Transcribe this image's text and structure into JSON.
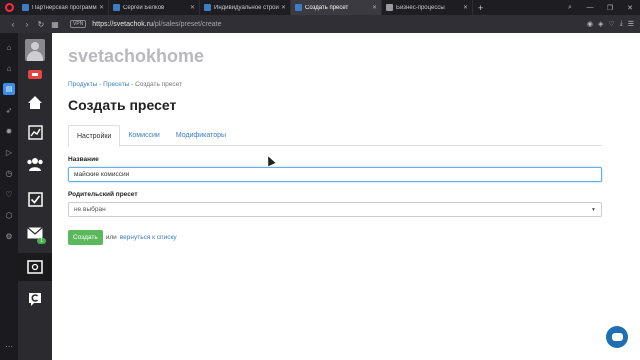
{
  "browser": {
    "tabs": [
      {
        "label": "Партнерская программа",
        "active": false
      },
      {
        "label": "Сергей Белков",
        "active": false
      },
      {
        "label": "Индивидуальное строит...",
        "active": false
      },
      {
        "label": "Создать пресет",
        "active": true
      },
      {
        "label": "Бизнес-процессы",
        "active": false
      }
    ],
    "vpn_label": "VPN",
    "url_main": "https://svetachok.ru",
    "url_path": "/pl/sales/preset/create"
  },
  "app_sidebar": {
    "notification_badge": "1"
  },
  "page": {
    "username": "svetachokhome",
    "breadcrumb": {
      "item1": "Продукты",
      "sep": " - ",
      "item2": "Пресеты",
      "current": "Создать пресет"
    },
    "title": "Создать пресет",
    "tabs": [
      {
        "label": "Настройки",
        "active": true
      },
      {
        "label": "Комиссии",
        "active": false
      },
      {
        "label": "Модификаторы",
        "active": false
      }
    ],
    "name_label": "Название",
    "name_value": "майские комиссии",
    "parent_label": "Родительский пресет",
    "parent_value": "не выбран",
    "create_button": "Создать",
    "or_text": "или",
    "back_link": "вернуться к списку"
  },
  "colors": {
    "accent": "#3b7ec4",
    "create_button": "#5cb85c",
    "sidebar": "#2b2b2f"
  }
}
